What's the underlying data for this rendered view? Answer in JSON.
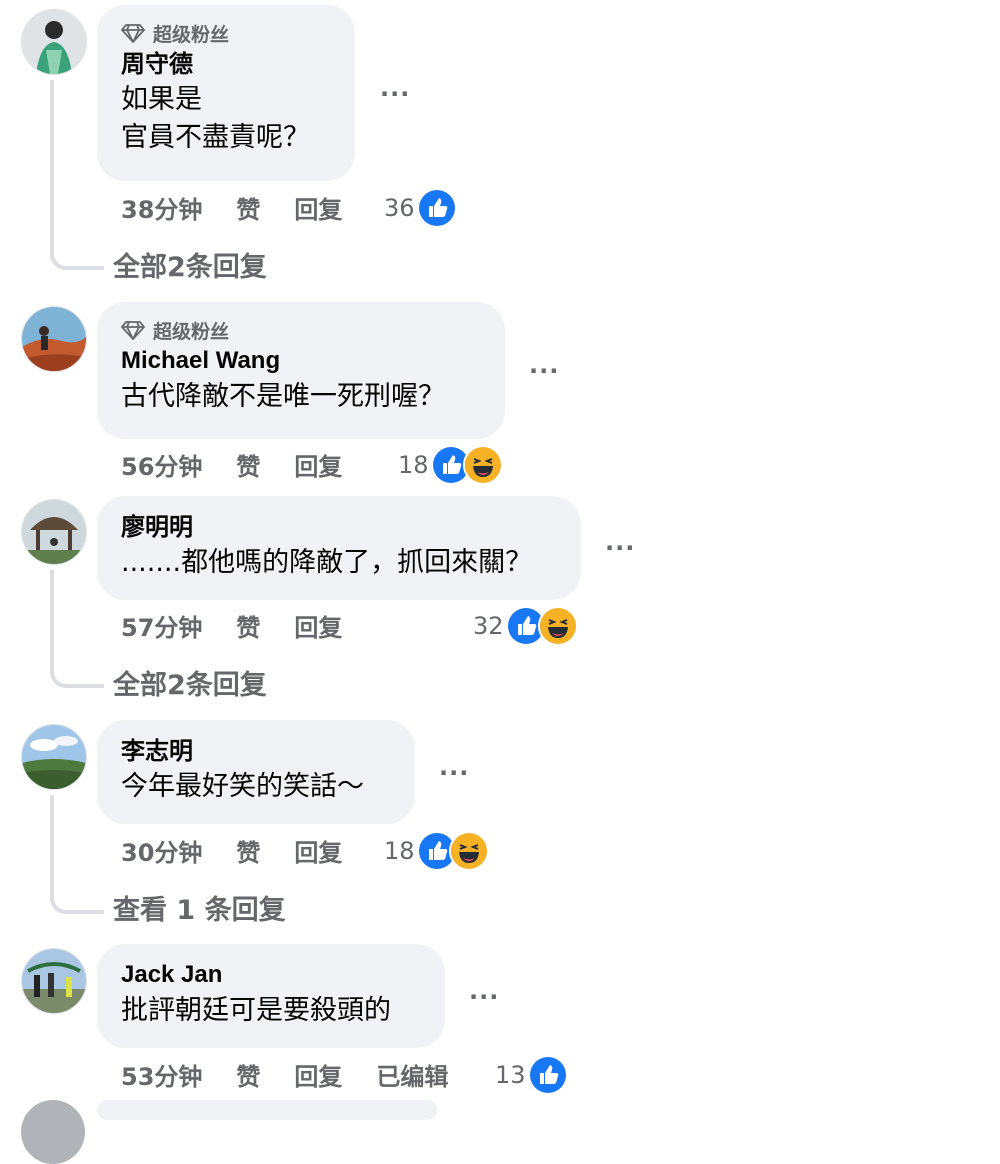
{
  "comments": [
    {
      "badge": "超级粉丝",
      "author": "周守德",
      "text": "如果是\n官員不盡責呢？",
      "time": "38分钟",
      "like": "赞",
      "reply": "回复",
      "count": "36",
      "reactions": [
        "like-icon"
      ],
      "view_replies": "全部2条回复"
    },
    {
      "badge": "超级粉丝",
      "author": "Michael Wang",
      "text": "古代降敵不是唯一死刑喔？",
      "time": "56分钟",
      "like": "赞",
      "reply": "回复",
      "count": "18",
      "reactions": [
        "like-icon",
        "haha-icon"
      ]
    },
    {
      "author": "廖明明",
      "text": ".......都他嗎的降敵了，抓回來關？",
      "time": "57分钟",
      "like": "赞",
      "reply": "回复",
      "count": "32",
      "reactions": [
        "like-icon",
        "haha-icon"
      ],
      "view_replies": "全部2条回复"
    },
    {
      "author": "李志明",
      "text": "今年最好笑的笑話～",
      "time": "30分钟",
      "like": "赞",
      "reply": "回复",
      "count": "18",
      "reactions": [
        "like-icon",
        "haha-icon"
      ],
      "view_replies": "查看 1 条回复"
    },
    {
      "author": "Jack Jan",
      "text": "批評朝廷可是要殺頭的",
      "time": "53分钟",
      "like": "赞",
      "reply": "回复",
      "edited": "已编辑",
      "count": "13",
      "reactions": [
        "like-icon"
      ]
    }
  ],
  "more_label": "···",
  "colors": {
    "like_blue": "#1877f2",
    "haha_yellow": "#f7b125",
    "muted": "#65676b",
    "bubble": "#f0f2f5"
  }
}
